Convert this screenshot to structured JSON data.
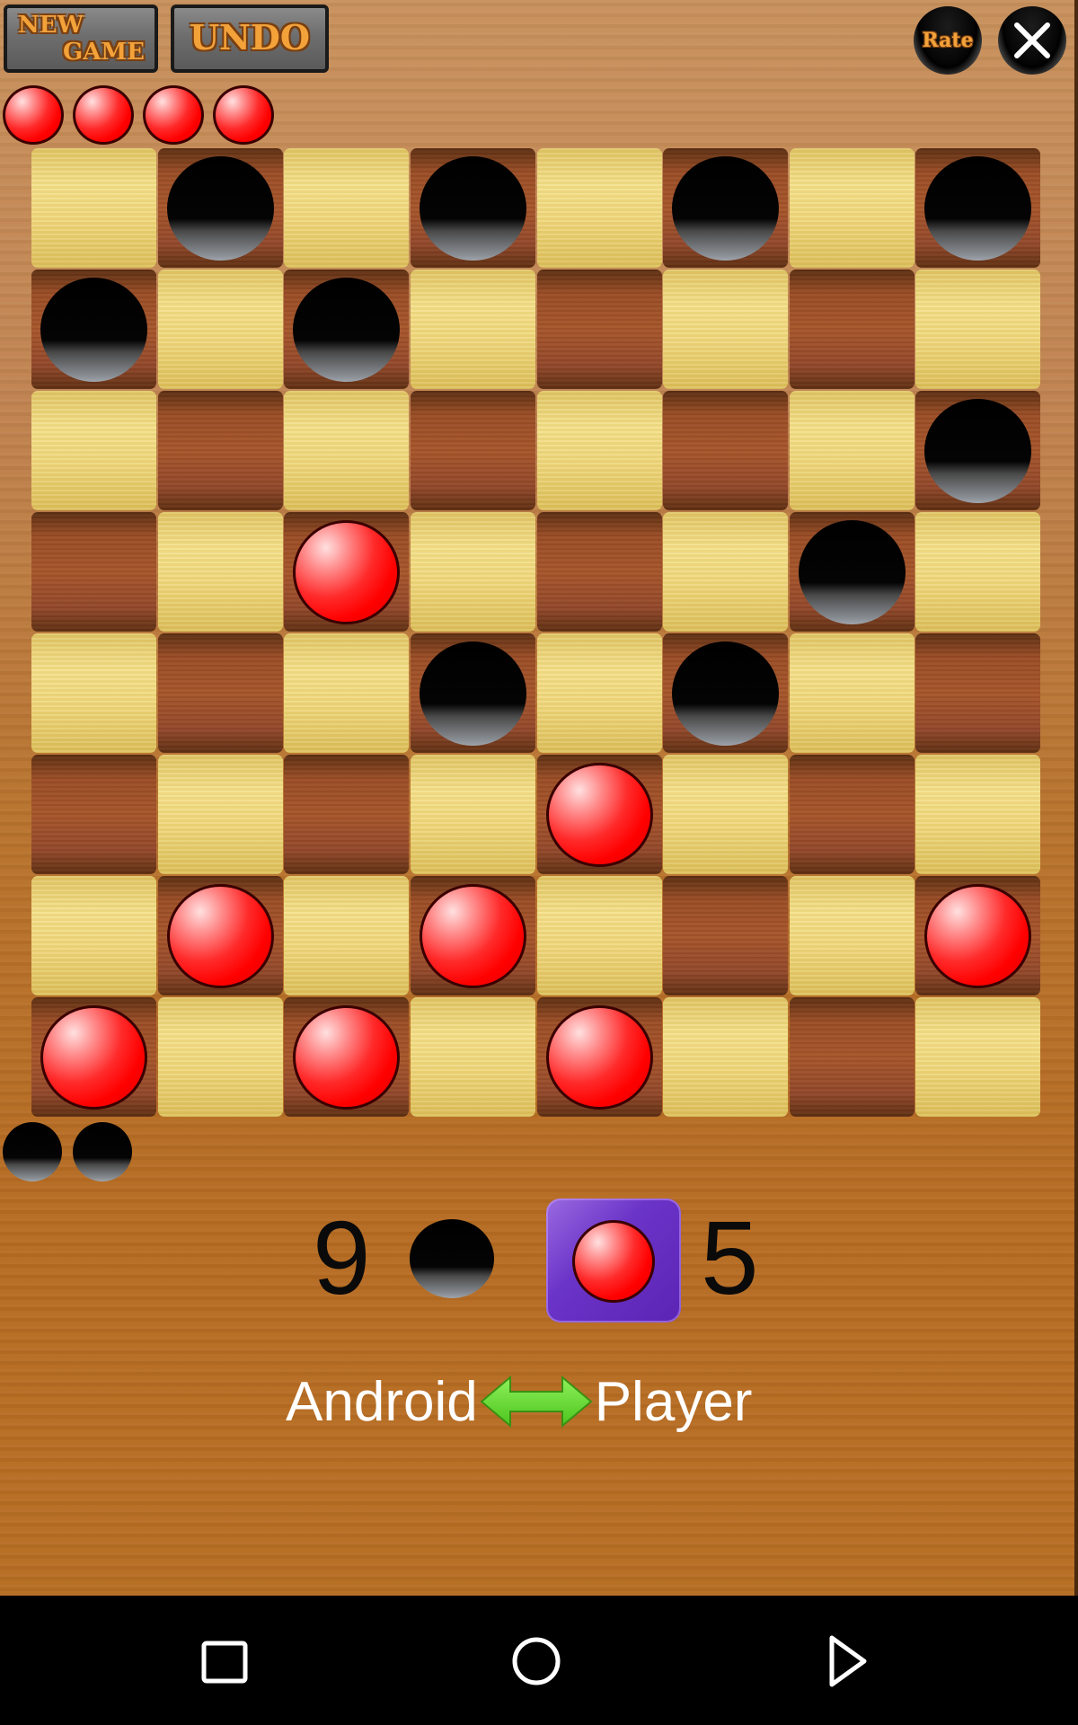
{
  "toolbar": {
    "new_game_line1": "NEW",
    "new_game_line2": "GAME",
    "undo_label": "UNDO",
    "rate_label": "Rate",
    "close_icon": "close-x-icon"
  },
  "colors": {
    "red_piece": "#ff0000",
    "black_piece": "#000000",
    "light_square": "#f0d97e",
    "dark_square": "#a0522d",
    "turn_highlight": "#6b34c8",
    "arrow": "#5fd62a",
    "button_text": "#f3a23a"
  },
  "captured": {
    "red_count": 4,
    "black_count": 2
  },
  "board": {
    "size": 8,
    "pieces": [
      {
        "row": 0,
        "col": 1,
        "color": "black"
      },
      {
        "row": 0,
        "col": 3,
        "color": "black"
      },
      {
        "row": 0,
        "col": 5,
        "color": "black"
      },
      {
        "row": 0,
        "col": 7,
        "color": "black"
      },
      {
        "row": 1,
        "col": 0,
        "color": "black"
      },
      {
        "row": 1,
        "col": 2,
        "color": "black"
      },
      {
        "row": 2,
        "col": 7,
        "color": "black"
      },
      {
        "row": 3,
        "col": 2,
        "color": "red"
      },
      {
        "row": 3,
        "col": 6,
        "color": "black"
      },
      {
        "row": 4,
        "col": 3,
        "color": "black"
      },
      {
        "row": 4,
        "col": 5,
        "color": "black"
      },
      {
        "row": 5,
        "col": 4,
        "color": "red"
      },
      {
        "row": 6,
        "col": 1,
        "color": "red"
      },
      {
        "row": 6,
        "col": 3,
        "color": "red"
      },
      {
        "row": 6,
        "col": 7,
        "color": "red"
      },
      {
        "row": 7,
        "col": 0,
        "color": "red"
      },
      {
        "row": 7,
        "col": 2,
        "color": "red"
      },
      {
        "row": 7,
        "col": 4,
        "color": "red"
      }
    ]
  },
  "status": {
    "black_score": "9",
    "red_score": "5",
    "current_turn": "red",
    "left_player": "Android",
    "right_player": "Player",
    "swap_icon": "double-arrow-icon"
  },
  "navbar": {
    "back": "back-triangle-icon",
    "home": "home-circle-icon",
    "recents": "recents-square-icon"
  }
}
